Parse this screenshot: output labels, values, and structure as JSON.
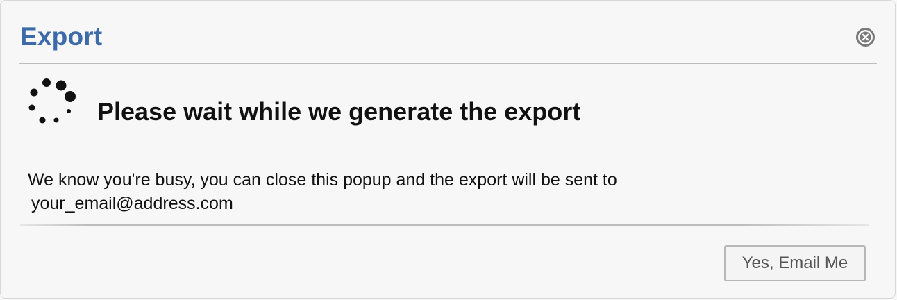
{
  "dialog": {
    "title": "Export",
    "close_icon": "close-circle-icon",
    "spinner_icon": "loading-spinner-icon",
    "heading": "Please wait while we generate the export",
    "message_line1": "We know you're busy, you can close this popup and the export will be sent to",
    "email": "your_email@address.com",
    "button_label": "Yes, Email Me"
  },
  "colors": {
    "title": "#3d6aa8",
    "background": "#f7f7f7",
    "text": "#111111",
    "close_icon": "#7a7a7a",
    "button_border": "#b7b7b7",
    "button_text": "#555555"
  }
}
